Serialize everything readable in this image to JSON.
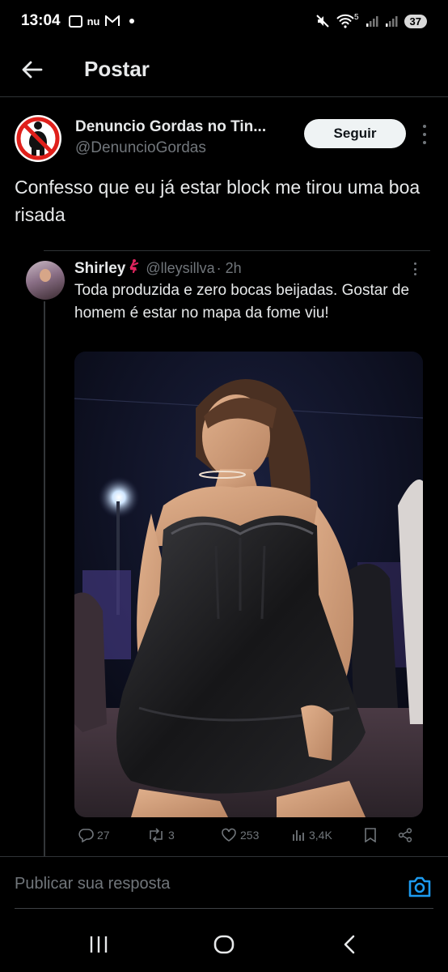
{
  "status_bar": {
    "time": "13:04",
    "carrier_text": "nu",
    "battery": "37",
    "network": "5"
  },
  "header": {
    "title": "Postar"
  },
  "post": {
    "author_name": "Denuncio Gordas no Tin...",
    "author_handle": "@DenuncioGordas",
    "follow_label": "Seguir",
    "text": "Confesso que eu já estar block me tirou uma boa risada"
  },
  "quoted": {
    "name": "Shirley",
    "handle": "@lleysillva",
    "time": "· 2h",
    "text": "Toda produzida e zero bocas beijadas. Gostar de homem é estar no mapa da fome viu!",
    "stats": {
      "replies": "27",
      "reposts": "3",
      "likes": "253",
      "views": "3,4K"
    }
  },
  "composer": {
    "placeholder": "Publicar sua resposta"
  },
  "colors": {
    "background": "#000000",
    "text_primary": "#e7e9ea",
    "text_secondary": "#71767b",
    "accent": "#1d9bf0",
    "divider": "#2f3336"
  },
  "icons": [
    "back-arrow-icon",
    "more-vertical-icon",
    "reply-icon",
    "repost-icon",
    "like-icon",
    "views-icon",
    "bookmark-icon",
    "share-icon",
    "camera-icon",
    "nav-recents-icon",
    "nav-home-icon",
    "nav-back-icon"
  ]
}
